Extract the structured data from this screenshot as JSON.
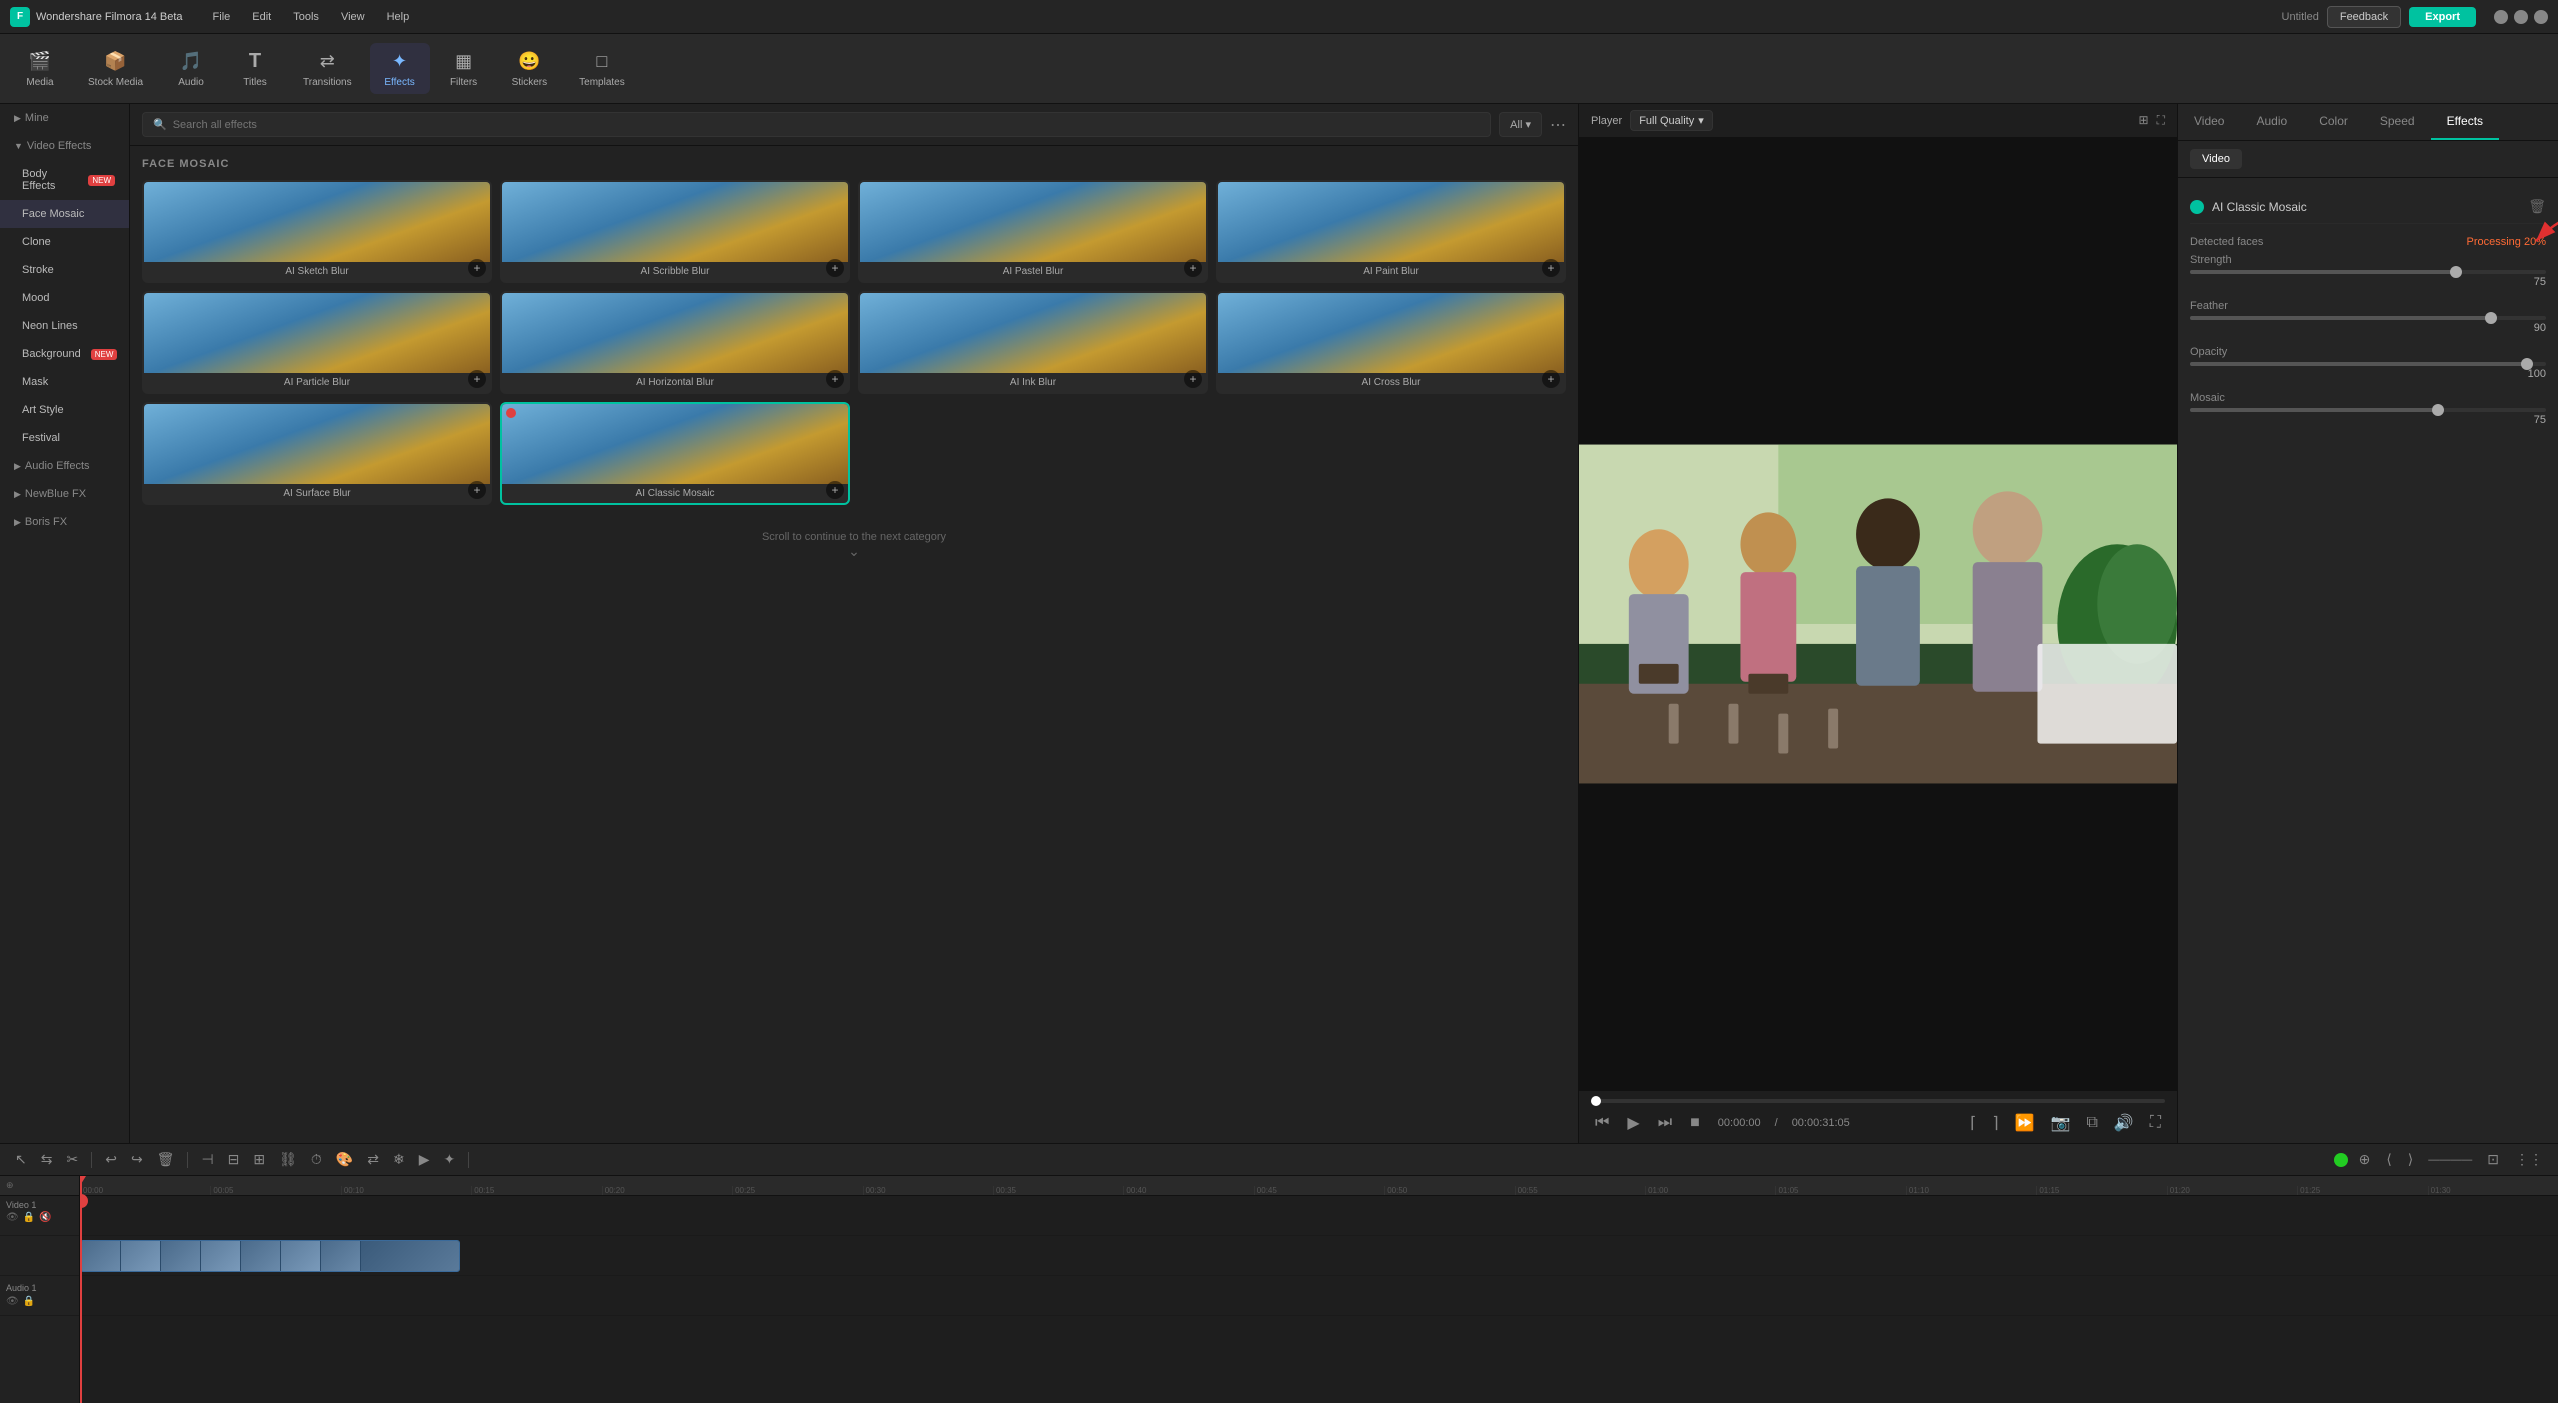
{
  "app": {
    "title": "Wondershare Filmora 14 Beta",
    "project_name": "Untitled"
  },
  "menu": {
    "items": [
      "File",
      "Edit",
      "Tools",
      "View",
      "Help"
    ]
  },
  "top_right": {
    "feedback_label": "Feedback",
    "export_label": "Export"
  },
  "toolbar": {
    "items": [
      {
        "id": "media",
        "label": "Media",
        "icon": "🎬"
      },
      {
        "id": "stock_media",
        "label": "Stock Media",
        "icon": "📦"
      },
      {
        "id": "audio",
        "label": "Audio",
        "icon": "🎵"
      },
      {
        "id": "titles",
        "label": "Titles",
        "icon": "T"
      },
      {
        "id": "transitions",
        "label": "Transitions",
        "icon": "⇄"
      },
      {
        "id": "effects",
        "label": "Effects",
        "icon": "✦"
      },
      {
        "id": "filters",
        "label": "Filters",
        "icon": "▦"
      },
      {
        "id": "stickers",
        "label": "Stickers",
        "icon": "😀"
      },
      {
        "id": "templates",
        "label": "Templates",
        "icon": "□"
      }
    ]
  },
  "left_panel": {
    "sections": [
      {
        "id": "mine",
        "label": "Mine",
        "expanded": true,
        "items": []
      },
      {
        "id": "video_effects",
        "label": "Video Effects",
        "expanded": true,
        "items": [
          {
            "id": "body_effects",
            "label": "Body Effects",
            "badge": "new"
          },
          {
            "id": "face_mosaic",
            "label": "Face Mosaic",
            "active": true
          },
          {
            "id": "clone",
            "label": "Clone"
          },
          {
            "id": "stroke",
            "label": "Stroke"
          },
          {
            "id": "mood",
            "label": "Mood"
          },
          {
            "id": "neon_lines",
            "label": "Neon Lines"
          },
          {
            "id": "background",
            "label": "Background",
            "badge": "new"
          },
          {
            "id": "mask",
            "label": "Mask"
          },
          {
            "id": "art_style",
            "label": "Art Style"
          },
          {
            "id": "festival",
            "label": "Festival"
          }
        ]
      },
      {
        "id": "audio_effects",
        "label": "Audio Effects",
        "expanded": false,
        "items": []
      },
      {
        "id": "newblue_fx",
        "label": "NewBlue FX",
        "expanded": false,
        "items": []
      },
      {
        "id": "boris_fx",
        "label": "Boris FX",
        "expanded": false,
        "items": []
      }
    ]
  },
  "effects_grid": {
    "category": "FACE MOSAIC",
    "search_placeholder": "Search all effects",
    "filter_label": "All",
    "items": [
      {
        "id": "ai_sketch_blur",
        "label": "AI Sketch Blur",
        "thumb_class": "thumb-sketch"
      },
      {
        "id": "ai_scribble_blur",
        "label": "AI Scribble Blur",
        "thumb_class": "thumb-scribble"
      },
      {
        "id": "ai_pastel_blur",
        "label": "AI Pastel Blur",
        "thumb_class": "thumb-pastel"
      },
      {
        "id": "ai_paint_blur",
        "label": "AI Paint Blur",
        "thumb_class": "thumb-paint"
      },
      {
        "id": "ai_particle_blur",
        "label": "AI Particle Blur",
        "thumb_class": "thumb-particle"
      },
      {
        "id": "ai_horizontal_blur",
        "label": "AI Horizontal Blur",
        "thumb_class": "thumb-horizontal"
      },
      {
        "id": "ai_ink_blur",
        "label": "AI Ink Blur",
        "thumb_class": "thumb-ink"
      },
      {
        "id": "ai_cross_blur",
        "label": "AI Cross Blur",
        "thumb_class": "thumb-cross"
      },
      {
        "id": "ai_surface_blur",
        "label": "AI Surface Blur",
        "thumb_class": "thumb-surface"
      },
      {
        "id": "ai_classic_mosaic",
        "label": "AI Classic Mosaic",
        "thumb_class": "thumb-classic",
        "selected": true
      }
    ],
    "scroll_hint": "Scroll to continue to the next category"
  },
  "preview": {
    "player_label": "Player",
    "quality_label": "Full Quality",
    "time_current": "00:00:00",
    "time_total": "00:00:31:05",
    "time_separator": "/"
  },
  "right_panel": {
    "tabs": [
      "Video",
      "Audio",
      "Color",
      "Speed",
      "Effects"
    ],
    "active_tab": "Effects",
    "subtabs": [
      "Video"
    ],
    "active_subtab": "Video",
    "active_effect": "AI Classic Mosaic",
    "detected_faces_label": "Detected faces",
    "processing_label": "Processing 20%",
    "sliders": [
      {
        "label": "Strength",
        "value": 75,
        "display_value": "75"
      },
      {
        "label": "Feather",
        "value": 85,
        "display_value": "90"
      },
      {
        "label": "Opacity",
        "value": 95,
        "display_value": "100"
      },
      {
        "label": "Mosaic",
        "value": 70,
        "display_value": "75"
      }
    ]
  },
  "timeline": {
    "toolbar_buttons": [
      "✂",
      "🗑",
      "↩",
      "↪",
      "⊖",
      "⊕",
      "⬛",
      "◎",
      "⟳",
      "↺",
      "↻"
    ],
    "tracks": [
      {
        "label": "Video 1",
        "type": "video",
        "has_clip": true
      },
      {
        "label": "Audio 1",
        "type": "audio",
        "has_clip": false
      }
    ],
    "ruler_marks": [
      "00:00",
      "00:05",
      "00:10",
      "00:15",
      "00:20",
      "00:25",
      "00:30",
      "00:35",
      "00:40",
      "00:45",
      "00:50",
      "00:55",
      "01:00",
      "01:05",
      "01:10",
      "01:15",
      "01:20",
      "01:25",
      "01:30"
    ],
    "playhead_position": "0%"
  }
}
